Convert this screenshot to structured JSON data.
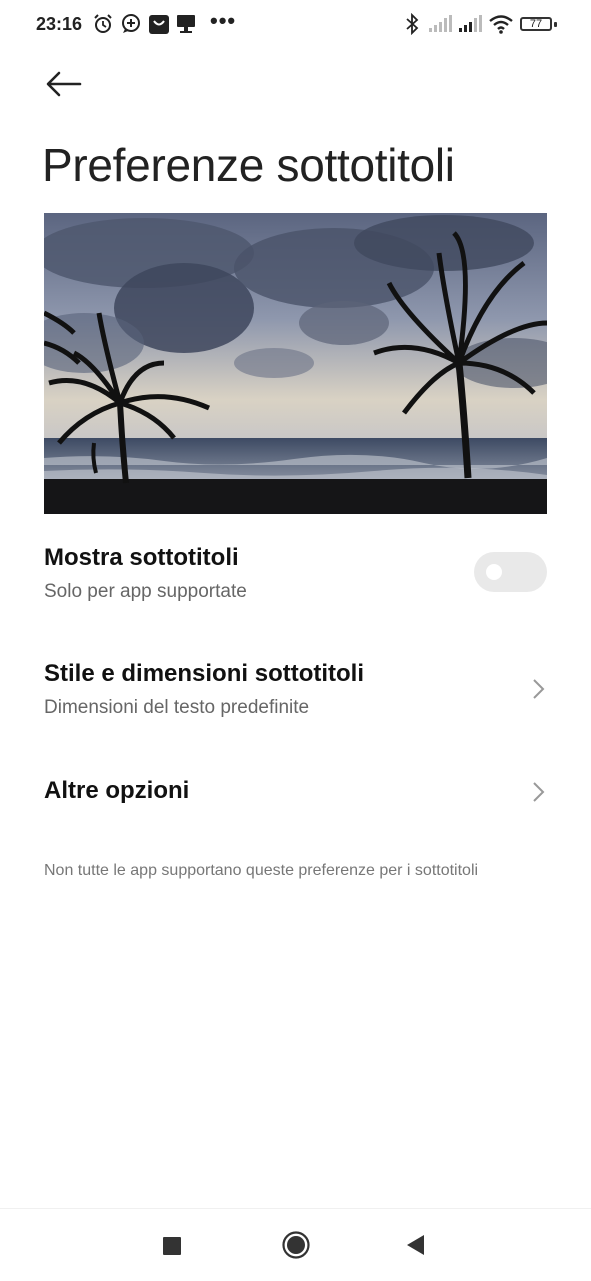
{
  "status_bar": {
    "time": "23:16",
    "battery": "77",
    "icons": [
      "alarm-icon",
      "whatsapp-icon",
      "shop-icon",
      "pinned-notification-icon",
      "more-dots-icon",
      "bluetooth-icon",
      "signal-icon",
      "signal-icon",
      "wifi-icon",
      "battery-icon"
    ],
    "more": "•••"
  },
  "header": {
    "title": "Preferenze sottotitoli",
    "back_icon": "arrow-left-icon"
  },
  "settings": {
    "show_subtitles": {
      "title": "Mostra sottotitoli",
      "subtitle": "Solo per app supportate",
      "enabled": false
    },
    "style_size": {
      "title": "Stile e dimensioni sottotitoli",
      "subtitle": "Dimensioni del testo predefinite"
    },
    "more_options": {
      "title": "Altre opzioni"
    }
  },
  "footnote": "Non tutte le app supportano queste preferenze per i sottotitoli",
  "nav_bar": {
    "icons": [
      "recents-icon",
      "home-icon",
      "back-icon"
    ]
  },
  "colors": {
    "text_primary": "#111111",
    "text_secondary": "#666666",
    "toggle_off": "#e9e9e9"
  }
}
